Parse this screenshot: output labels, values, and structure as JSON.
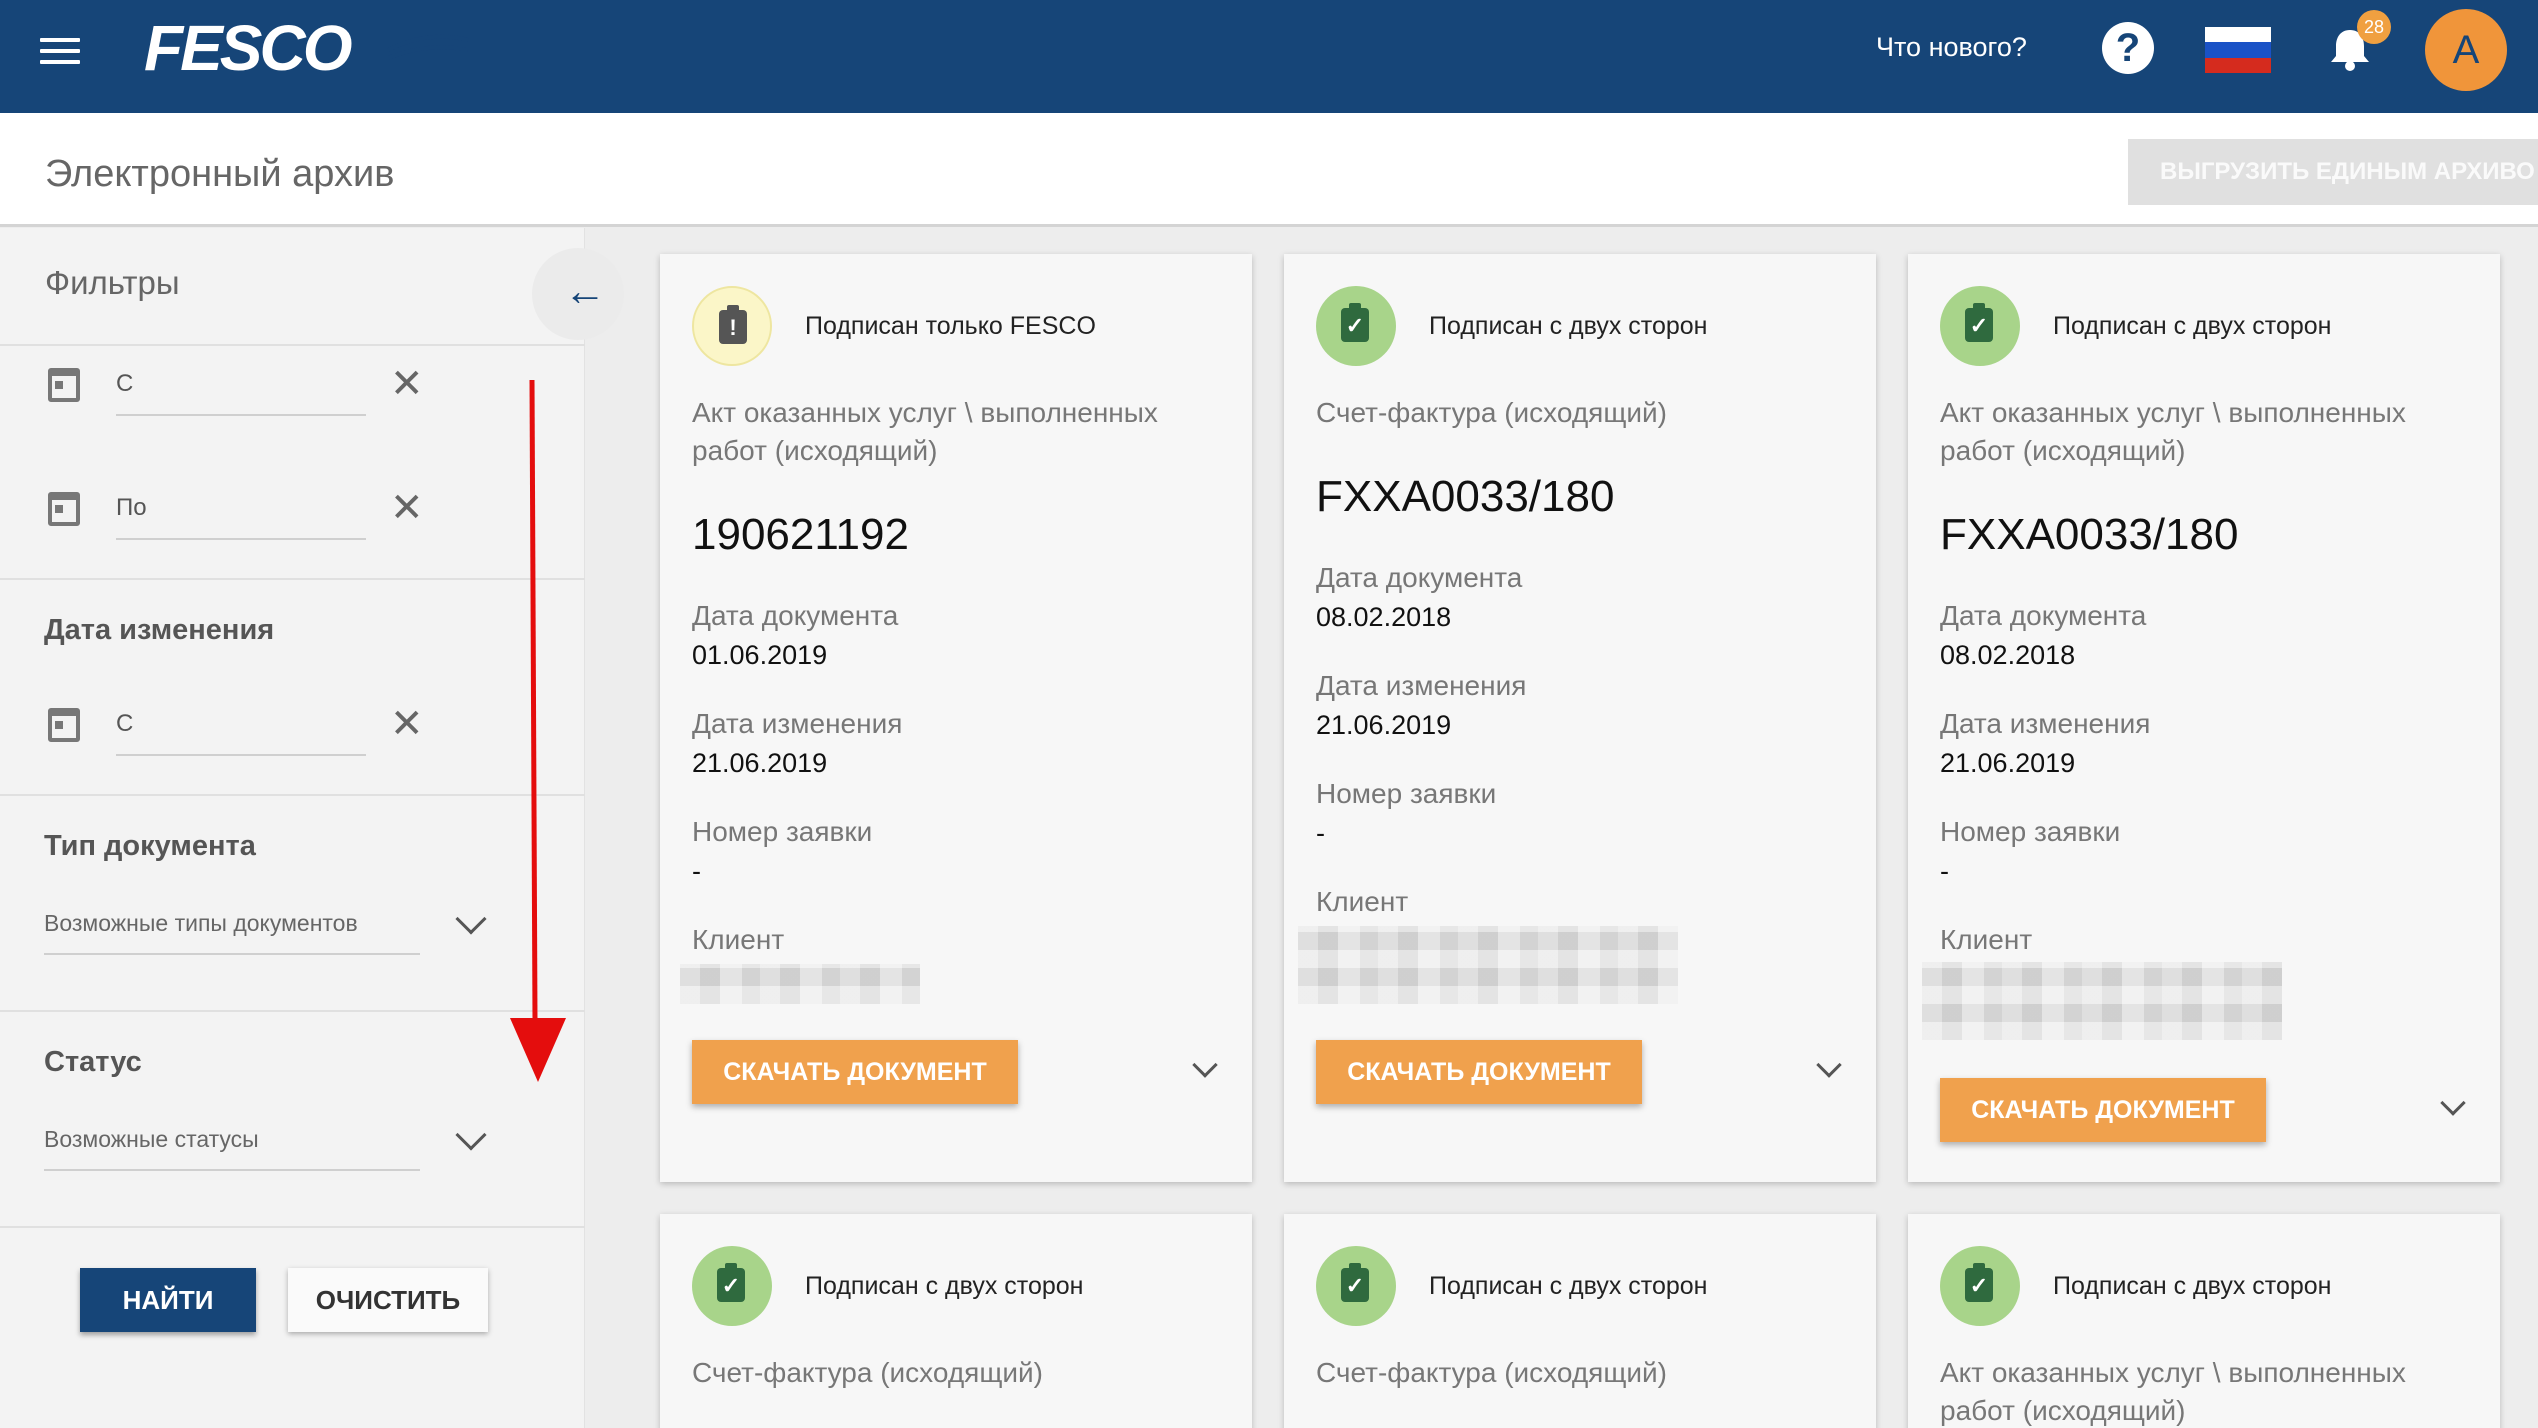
{
  "header": {
    "logo_text": "FESCO",
    "whats_new": "Что нового?",
    "help_glyph": "?",
    "notifications_count": "28",
    "avatar_letter": "А",
    "flag_colors": [
      "#ffffff",
      "#1a52c6",
      "#d52b1e"
    ],
    "brand_color": "#164578"
  },
  "subheader": {
    "title": "Электронный архив",
    "export_button": "ВЫГРУЗИТЬ ЕДИНЫМ АРХИВО"
  },
  "sidebar": {
    "title": "Фильтры",
    "from_placeholder": "С",
    "to_placeholder": "По",
    "change_date_title": "Дата изменения",
    "change_from_placeholder": "С",
    "doc_type_title": "Тип документа",
    "doc_type_placeholder": "Возможные типы документов",
    "status_title": "Статус",
    "status_placeholder": "Возможные статусы",
    "find_button": "НАЙТИ",
    "clear_button": "ОЧИСТИТЬ"
  },
  "labels": {
    "doc_date": "Дата документа",
    "change_date": "Дата изменения",
    "request_number": "Номер заявки",
    "client": "Клиент",
    "download": "СКАЧАТЬ ДОКУМЕНТ"
  },
  "cards": [
    {
      "status": "Подписан только FESCO",
      "status_kind": "warning",
      "doc_type": "Акт оказанных услуг \\ выполненных работ (исходящий)",
      "number": "190621192",
      "doc_date": "01.06.2019",
      "change_date": "21.06.2019",
      "request_number": "-"
    },
    {
      "status": "Подписан с двух сторон",
      "status_kind": "signed",
      "doc_type": "Счет-фактура (исходящий)",
      "number": "FXXA0033/180",
      "doc_date": "08.02.2018",
      "change_date": "21.06.2019",
      "request_number": "-"
    },
    {
      "status": "Подписан с двух сторон",
      "status_kind": "signed",
      "doc_type": "Акт оказанных услуг \\ выполненных работ (исходящий)",
      "number": "FXXA0033/180",
      "doc_date": "08.02.2018",
      "change_date": "21.06.2019",
      "request_number": "-"
    },
    {
      "status": "Подписан с двух сторон",
      "status_kind": "signed",
      "doc_type": "Счет-фактура (исходящий)"
    },
    {
      "status": "Подписан с двух сторон",
      "status_kind": "signed",
      "doc_type": "Счет-фактура (исходящий)"
    },
    {
      "status": "Подписан с двух сторон",
      "status_kind": "signed",
      "doc_type": "Акт оказанных услуг \\ выполненных работ (исходящий)"
    }
  ]
}
